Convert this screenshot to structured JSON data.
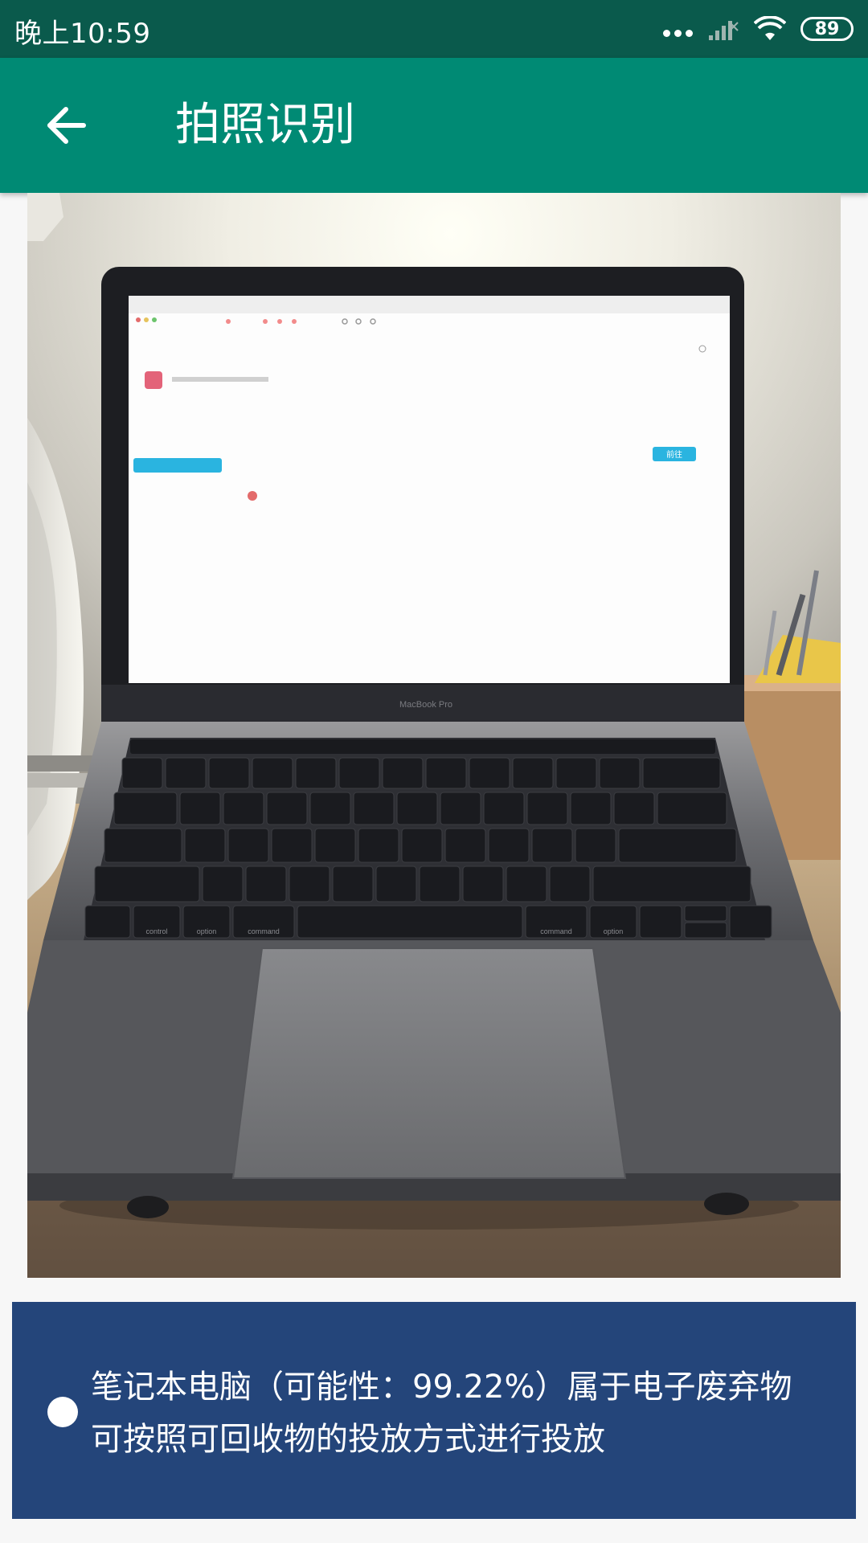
{
  "status_bar": {
    "time": "晚上10:59",
    "battery": "89",
    "icons": [
      "more-dots-icon",
      "signal-icon",
      "wifi-icon",
      "battery-icon"
    ]
  },
  "app_bar": {
    "back_icon": "arrow-left-icon",
    "title": "拍照识别"
  },
  "photo": {
    "subject": "laptop",
    "laptop_brand_text": "MacBook Pro",
    "screen_button_label": "前往",
    "keyboard_labels": [
      "control",
      "option",
      "command",
      "command",
      "option"
    ]
  },
  "result": {
    "bullet_icon": "circle-bullet-icon",
    "line1": "笔记本电脑（可能性：99.22%）属于电子废弃物",
    "line2": "可按照可回收物的投放方式进行投放"
  },
  "colors": {
    "status_bar": "#0a5a4c",
    "app_bar": "#008a74",
    "result_card": "#24457a",
    "page_background": "#f7f7f7"
  }
}
